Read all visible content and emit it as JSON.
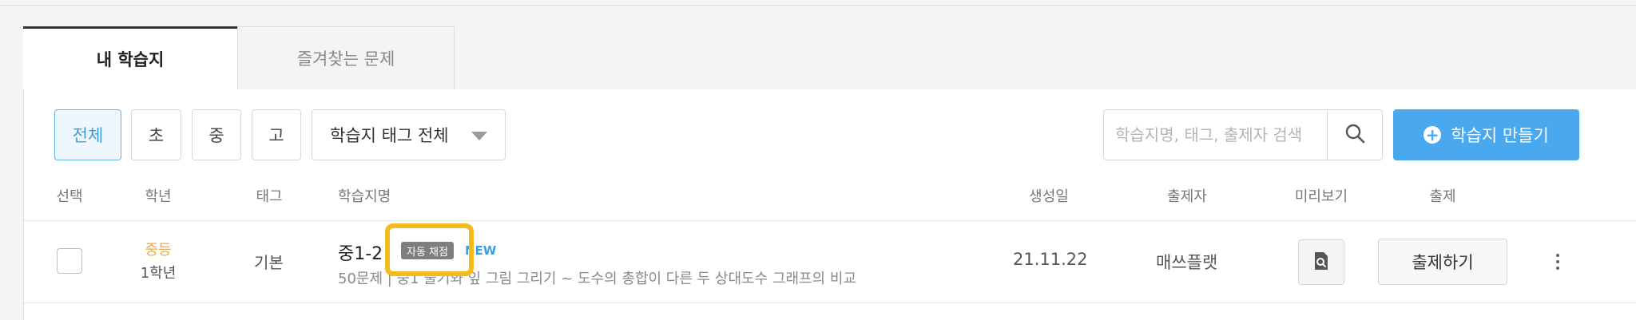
{
  "tabs": [
    {
      "label": "내 학습지",
      "active": true
    },
    {
      "label": "즐겨찾는 문제",
      "active": false
    }
  ],
  "filters": {
    "grades": [
      "전체",
      "초",
      "중",
      "고"
    ],
    "selected_grade": "전체",
    "tag_select": {
      "value": "학습지 태그 전체",
      "icon": "caret-down-icon"
    }
  },
  "search": {
    "placeholder": "학습지명, 태그, 출제자 검색",
    "value": "",
    "icon": "search-icon"
  },
  "create_button": {
    "label": "학습지 만들기",
    "icon": "plus-circle-icon"
  },
  "table": {
    "headers": {
      "select": "선택",
      "grade": "학년",
      "tag": "태그",
      "name": "학습지명",
      "created": "생성일",
      "author": "출제자",
      "preview": "미리보기",
      "assign": "출제"
    },
    "rows": [
      {
        "grade_level": "중등",
        "grade_year": "1학년",
        "tag": "기본",
        "title": "중1-2",
        "auto_badge": "자동 채점",
        "new_badge": "NEW",
        "description": "50문제 | 중1 줄기와 잎 그림 그리기 ~ 도수의 총합이 다른 두 상대도수 그래프의 비교",
        "created": "21.11.22",
        "author": "매쓰플랫",
        "assign_label": "출제하기"
      }
    ]
  },
  "colors": {
    "accent": "#4aa8ee",
    "selected_chip_bg": "#eef7fd",
    "grade_level": "#f1a93a",
    "highlight": "#f5bb1c"
  }
}
